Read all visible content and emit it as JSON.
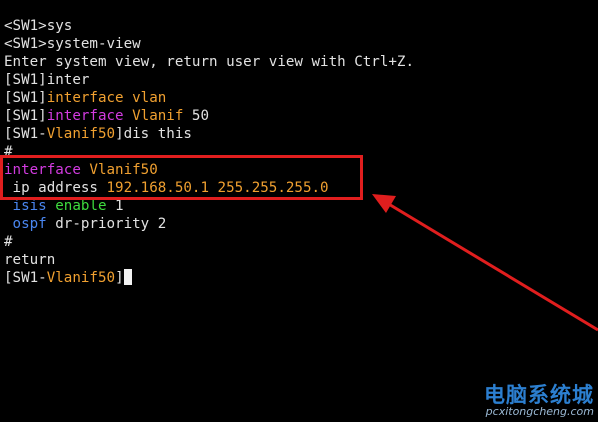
{
  "terminal": {
    "lines": [
      [
        {
          "t": "<SW1>sys",
          "c": ""
        }
      ],
      [
        {
          "t": "<SW1>system-view",
          "c": ""
        }
      ],
      [
        {
          "t": "Enter system view, return user view with Ctrl+Z.",
          "c": ""
        }
      ],
      [
        {
          "t": "[SW1]inter",
          "c": ""
        }
      ],
      [
        {
          "t": "[SW1]",
          "c": ""
        },
        {
          "t": "interface vlan",
          "c": "org"
        }
      ],
      [
        {
          "t": "[SW1]",
          "c": ""
        },
        {
          "t": "interface",
          "c": "mag"
        },
        {
          "t": " Vlanif",
          "c": "org"
        },
        {
          "t": " 50",
          "c": ""
        }
      ],
      [
        {
          "t": "[SW1-",
          "c": ""
        },
        {
          "t": "Vlanif50",
          "c": "org"
        },
        {
          "t": "]dis this",
          "c": ""
        }
      ],
      [
        {
          "t": "#",
          "c": ""
        }
      ],
      [
        {
          "t": "interface",
          "c": "mag"
        },
        {
          "t": " Vlanif50",
          "c": "org"
        }
      ],
      [
        {
          "t": " ip address ",
          "c": ""
        },
        {
          "t": "192.168.50.1 255.255.255.0",
          "c": "org"
        }
      ],
      [
        {
          "t": " isis",
          "c": "blu"
        },
        {
          "t": " enable",
          "c": "grn"
        },
        {
          "t": " 1",
          "c": ""
        }
      ],
      [
        {
          "t": " ospf",
          "c": "blu"
        },
        {
          "t": " dr-priority 2",
          "c": ""
        }
      ],
      [
        {
          "t": "#",
          "c": ""
        }
      ],
      [
        {
          "t": "return",
          "c": ""
        }
      ],
      [
        {
          "t": "[SW1-",
          "c": ""
        },
        {
          "t": "Vlanif50",
          "c": "org"
        },
        {
          "t": "]",
          "c": ""
        },
        {
          "t": "",
          "c": "cursor"
        }
      ]
    ]
  },
  "watermark": {
    "title": "电脑系统城",
    "url": "pcxitongcheng.com"
  },
  "colors": {
    "highlight": "#e01e1e",
    "keyword_magenta": "#d23be0",
    "value_orange": "#f0a030",
    "protocol_blue": "#4a86f0",
    "enable_green": "#3edc3e"
  }
}
